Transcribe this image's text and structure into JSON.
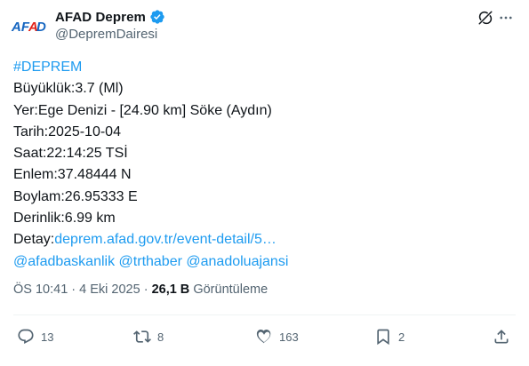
{
  "author": {
    "avatar_text": "AFAD",
    "display_name": "AFAD Deprem",
    "handle": "@DepremDairesi",
    "verified": true
  },
  "post": {
    "lines": {
      "hashtag": "#DEPREM",
      "magnitude": "Büyüklük:3.7 (Ml)",
      "location": "Yer:Ege Denizi - [24.90 km] Söke (Aydın)",
      "date": "Tarih:2025-10-04",
      "time": "Saat:22:14:25 TSİ",
      "latitude": "Enlem:37.48444 N",
      "longitude": "Boylam:26.95333 E",
      "depth": "Derinlik:6.99 km",
      "detail_label": "Detay:",
      "detail_link": "deprem.afad.gov.tr/event-detail/5…",
      "mention_1": "@afadbaskanlik",
      "mention_2": "@trthaber",
      "mention_3": "@anadoluajansi"
    }
  },
  "meta": {
    "timestamp": "ÖS 10:41 · 4 Eki 2025 ·",
    "views_count": "26,1 B",
    "views_label": "Görüntüleme"
  },
  "actions": {
    "replies": "13",
    "reposts": "8",
    "likes": "163",
    "bookmarks": "2"
  },
  "icons": {
    "verified": "verified-badge-icon",
    "grok": "grok-icon",
    "more": "more-icon",
    "reply": "reply-icon",
    "repost": "repost-icon",
    "like": "heart-icon",
    "bookmark": "bookmark-icon",
    "share": "share-icon"
  },
  "colors": {
    "link": "#1d9bf0",
    "brand_blue": "#1565c0",
    "brand_red": "#e2231a",
    "text_primary": "#0f1419",
    "text_secondary": "#536471"
  }
}
